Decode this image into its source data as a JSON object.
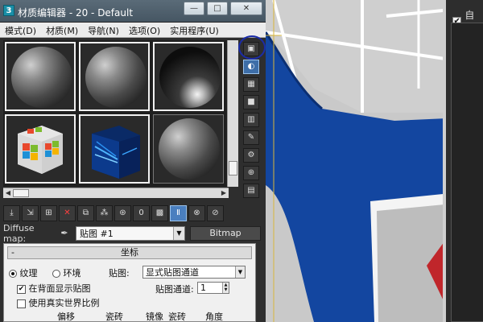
{
  "window": {
    "title": "材质编辑器 - 20 - Default",
    "app_icon": "3ds-max-icon",
    "buttons": {
      "minimize": "—",
      "maximize": "□",
      "close": "✕"
    }
  },
  "menu": [
    "模式(D)",
    "材质(M)",
    "导航(N)",
    "选项(O)",
    "实用程序(U)"
  ],
  "slots": [
    {
      "kind": "sphere-gray",
      "active": true
    },
    {
      "kind": "sphere-gray",
      "active": true
    },
    {
      "kind": "sphere-dark",
      "active": true
    },
    {
      "kind": "windows-logo-cube",
      "active": true
    },
    {
      "kind": "blue-light-cube",
      "active": true
    },
    {
      "kind": "sphere-gray",
      "active": false
    }
  ],
  "side_toolbar_icons": [
    "sample-type-icon",
    "backlight-icon",
    "background-checker-icon",
    "sample-uv-icon",
    "video-color-check-icon",
    "make-preview-icon",
    "options-icon",
    "select-by-material-icon",
    "material-map-navigator-icon"
  ],
  "bottom_toolbar_icons": [
    "get-material-icon",
    "put-to-scene-icon",
    "assign-to-selection-icon",
    "reset-map-icon",
    "make-copy-icon",
    "make-unique-icon",
    "put-to-library-icon",
    "material-id-channel-icon",
    "show-shaded-in-viewport-icon",
    "show-end-result-icon",
    "go-to-parent-icon",
    "go-forward-to-sibling-icon"
  ],
  "diffuse": {
    "label": "Diffuse map:",
    "map_name": "贴图 #1",
    "type_button": "Bitmap"
  },
  "rollout": {
    "title": "坐标",
    "collapse_symbol": "-",
    "mode_texture": "纹理",
    "mode_environ": "环境",
    "mapping_label": "贴图:",
    "mapping_value": "显式贴图通道",
    "show_map_back": "在背面显示贴图",
    "show_map_back_checked": true,
    "map_channel_label": "贴图通道:",
    "map_channel_value": "1",
    "real_world": "使用真实世界比例",
    "real_world_checked": false,
    "col_offset": "偏移",
    "col_tiling": "瓷砖",
    "col_mirror": "镜像",
    "col_tile": "瓷砖",
    "col_angle": "角度"
  },
  "viewport": {
    "auto_label": "自动",
    "auto_checked": true
  },
  "annotation": {
    "circle_color": "#1b2ca8"
  },
  "colors": {
    "viewport_blue": "#1346a0",
    "highlight": "#4a7fbf"
  }
}
